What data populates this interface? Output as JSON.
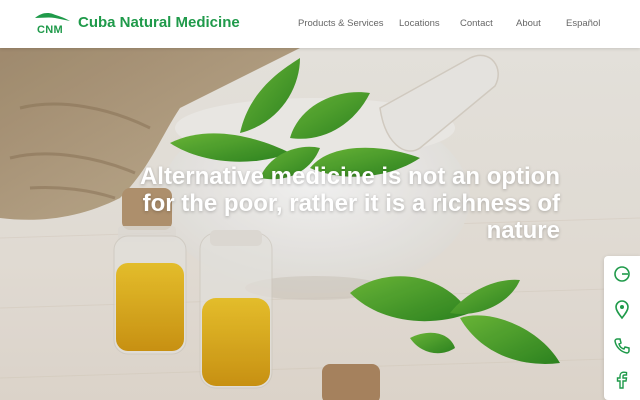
{
  "header": {
    "logo_abbr": "CNM",
    "brand_name": "Cuba Natural Medicine",
    "nav": {
      "products": "Products & Services",
      "locations": "Locations",
      "contact": "Contact",
      "about": "About",
      "language": "Español"
    }
  },
  "hero": {
    "headline": "Alternative medicine is not an option for the poor, rather it is a richness of nature"
  },
  "side_rail": {
    "icons": [
      "google-icon",
      "location-pin-icon",
      "phone-icon",
      "facebook-icon"
    ]
  },
  "colors": {
    "brand_green": "#1f9a4a",
    "nav_text": "#666666",
    "headline_text": "#ffffff",
    "rail_icon": "#1f9a4a"
  }
}
